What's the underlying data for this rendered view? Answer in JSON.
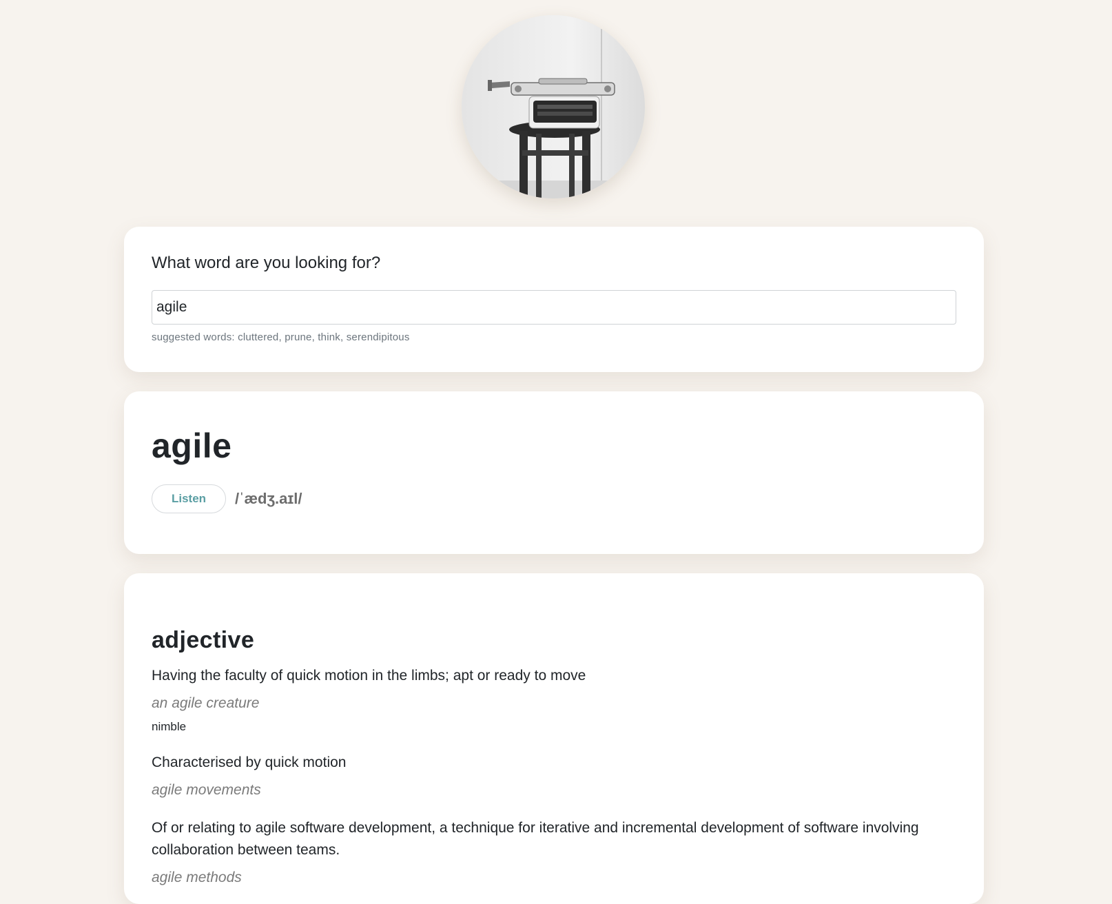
{
  "logo": {
    "icon": "typewriter-photo"
  },
  "search": {
    "heading": "What word are you looking for?",
    "value": "agile",
    "placeholder": "",
    "suggested": "suggested words: cluttered, prune, think, serendipitous"
  },
  "word": {
    "title": "agile",
    "listen_label": "Listen",
    "phonetic": "/ˈædʒ.aɪl/"
  },
  "meaning": {
    "part_of_speech": "adjective",
    "definitions": [
      {
        "text": "Having the faculty of quick motion in the limbs; apt or ready to move",
        "example": "an agile creature",
        "synonym": "nimble"
      },
      {
        "text": "Characterised by quick motion",
        "example": "agile movements"
      },
      {
        "text": "Of or relating to agile software development, a technique for iterative and incremental development of software involving collaboration between teams.",
        "example": "agile methods"
      }
    ]
  },
  "colors": {
    "background": "#f7f3ee",
    "card": "#ffffff",
    "accent": "#5a9ea3",
    "muted": "#6c757d"
  }
}
